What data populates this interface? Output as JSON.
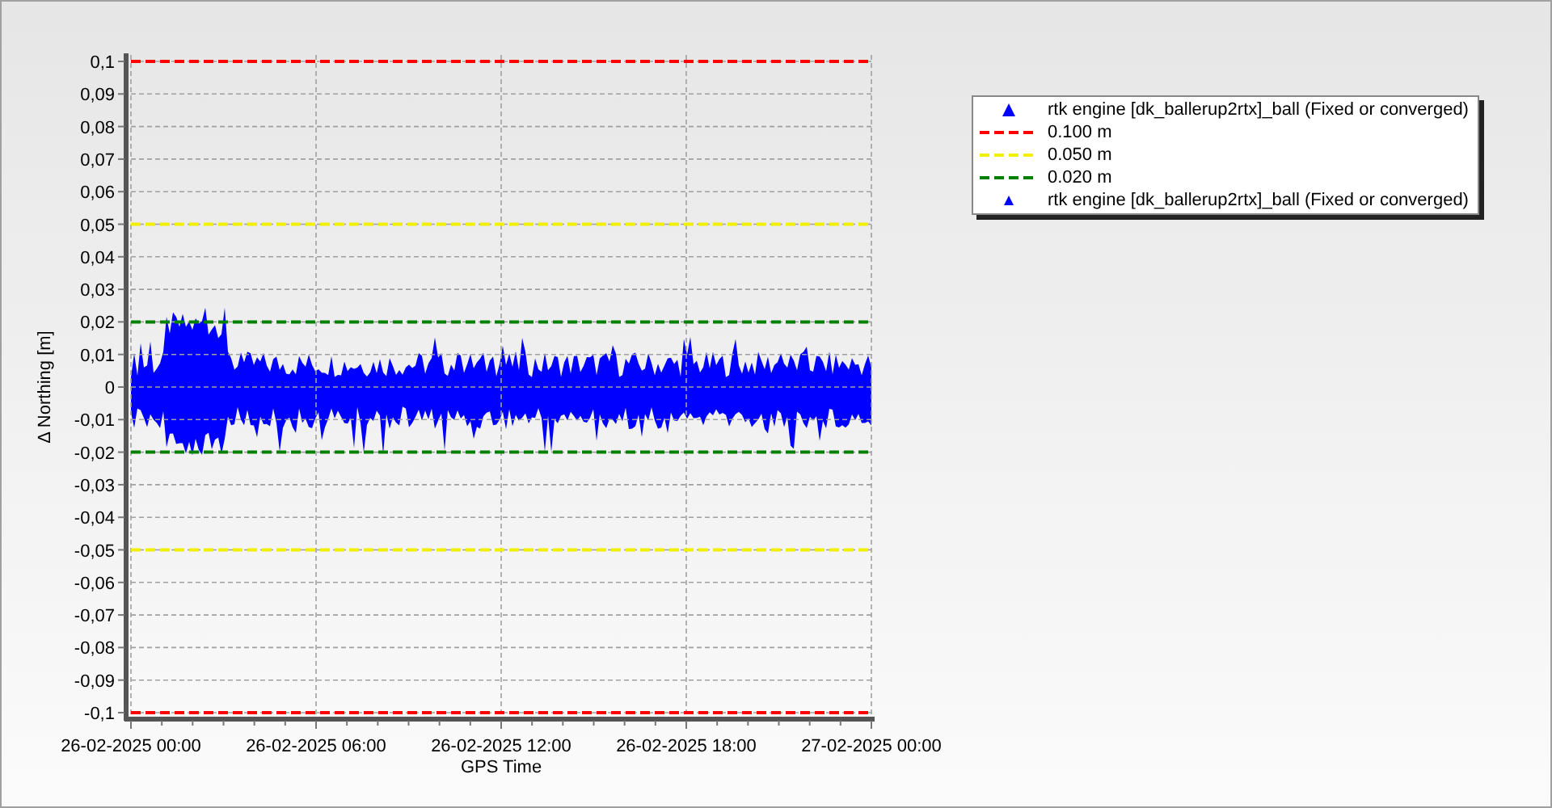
{
  "chart": {
    "chart_data": {
      "type": "line",
      "grid": true,
      "xlabel": "GPS Time",
      "ylabel": "Δ Northing [m]",
      "ylim": [
        -0.1,
        0.1
      ],
      "categories": [
        "26-02-2025 00:00",
        "26-02-2025 06:00",
        "26-02-2025 12:00",
        "26-02-2025 18:00",
        "27-02-2025 00:00"
      ],
      "yticks": [
        {
          "value": 0.1,
          "label": "0,1"
        },
        {
          "value": 0.09,
          "label": "0,09"
        },
        {
          "value": 0.08,
          "label": "0,08"
        },
        {
          "value": 0.07,
          "label": "0,07"
        },
        {
          "value": 0.06,
          "label": "0,06"
        },
        {
          "value": 0.05,
          "label": "0,05"
        },
        {
          "value": 0.04,
          "label": "0,04"
        },
        {
          "value": 0.03,
          "label": "0,03"
        },
        {
          "value": 0.02,
          "label": "0,02"
        },
        {
          "value": 0.01,
          "label": "0,01"
        },
        {
          "value": 0,
          "label": "0"
        },
        {
          "value": -0.01,
          "label": "-0,01"
        },
        {
          "value": -0.02,
          "label": "-0,02"
        },
        {
          "value": -0.03,
          "label": "-0,03"
        },
        {
          "value": -0.04,
          "label": "-0,04"
        },
        {
          "value": -0.05,
          "label": "-0,05"
        },
        {
          "value": -0.06,
          "label": "-0,06"
        },
        {
          "value": -0.07,
          "label": "-0,07"
        },
        {
          "value": -0.08,
          "label": "-0,08"
        },
        {
          "value": -0.09,
          "label": "-0,09"
        },
        {
          "value": -0.1,
          "label": "-0,1"
        }
      ],
      "series": [
        {
          "name": "0.100 m",
          "color": "#ff0000",
          "line_style": "dashed",
          "values": [
            0.1,
            0.1,
            0.1,
            0.1,
            0.1
          ]
        },
        {
          "name": "0.050 m",
          "color": "#f0f000",
          "line_style": "dashed",
          "values": [
            0.05,
            0.05,
            0.05,
            0.05,
            0.05
          ]
        },
        {
          "name": "0.020 m",
          "color": "#008000",
          "line_style": "dashed",
          "values": [
            0.02,
            0.02,
            0.02,
            0.02,
            0.02
          ]
        }
      ],
      "ref_lines": [
        {
          "axis": "y",
          "value": -0.1,
          "color": "#ff0000",
          "line_style": "dashed"
        },
        {
          "axis": "y",
          "value": -0.05,
          "color": "#f0f000",
          "line_style": "dashed"
        },
        {
          "axis": "y",
          "value": -0.02,
          "color": "#008000",
          "line_style": "dashed"
        }
      ]
    }
  },
  "legend": [
    {
      "kind": "marker-large",
      "label": "rtk engine [dk_ballerup2rtx]_ball (Fixed or converged)",
      "color": "#0000ff"
    },
    {
      "kind": "marker-small",
      "label": "rtk engine [dk_ballerup2rtx]_ball (Fixed or converged)",
      "color": "#0000ff"
    }
  ]
}
